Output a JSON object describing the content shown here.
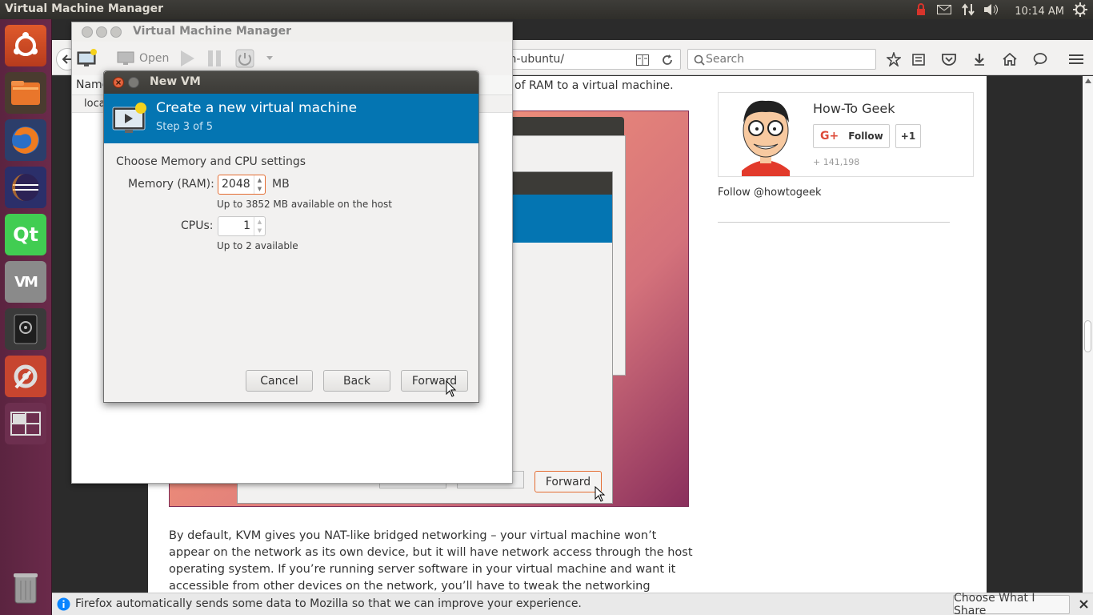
{
  "topbar": {
    "title": "Virtual Machine Manager",
    "clock": "10:14 AM"
  },
  "launcher": {
    "items": [
      "ubuntu-dash",
      "files",
      "firefox",
      "eclipse",
      "qt-creator",
      "virt-manager",
      "disk-utility",
      "system-settings",
      "workspace-switcher",
      "trash"
    ]
  },
  "browser": {
    "url": "ines-on-ubuntu/",
    "search_placeholder": "Search"
  },
  "article": {
    "top_fragment": "of RAM to a virtual machine.",
    "image_forward_label": "Forward",
    "body": "By default, KVM gives you NAT-like bridged networking – your virtual machine won’t appear on the network as its own device, but it will have network access through the host operating system. If you’re running server software in your virtual machine and want it accessible from other devices on the network, you’ll have to tweak the networking settings."
  },
  "sidebar": {
    "name": "How-To Geek",
    "follow_label": "Follow",
    "plus_one_label": "+1",
    "followers": "+ 141,198",
    "follow_twitter": "Follow @howtogeek"
  },
  "notification": {
    "text": "Firefox automatically sends some data to Mozilla so that we can improve your experience.",
    "choose_label": "Choose What I Share"
  },
  "vmm": {
    "title": "Virtual Machine Manager",
    "open_label": "Open",
    "column_name": "Name",
    "row_label": "local"
  },
  "newvm": {
    "title": "New VM",
    "header_title": "Create a new virtual machine",
    "header_step": "Step 3 of 5",
    "section_label": "Choose Memory and CPU settings",
    "memory_label": "Memory (RAM):",
    "memory_value": "2048",
    "memory_unit": "MB",
    "memory_hint": "Up to 3852 MB available on the host",
    "cpu_label": "CPUs:",
    "cpu_value": "1",
    "cpu_hint": "Up to 2 available",
    "cancel_label": "Cancel",
    "back_label": "Back",
    "forward_label": "Forward"
  },
  "colors": {
    "accent_orange": "#e46d32",
    "header_blue": "#0475b2",
    "launcher_purple": "#5b2440"
  }
}
